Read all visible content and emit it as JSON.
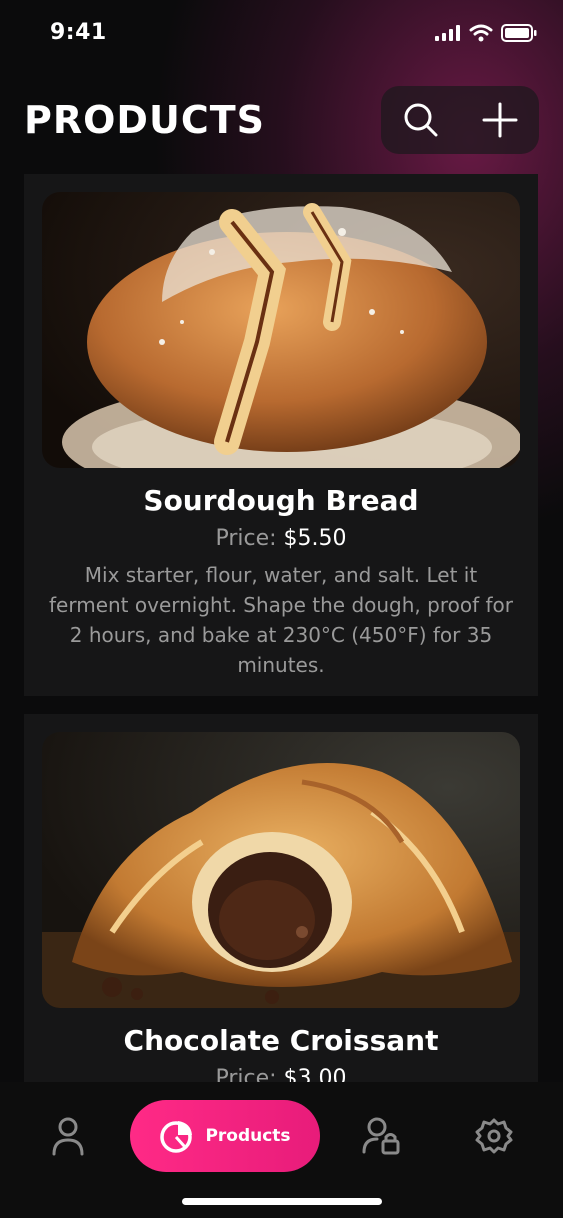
{
  "status": {
    "time": "9:41"
  },
  "header": {
    "title": "PRODUCTS"
  },
  "products": [
    {
      "name": "Sourdough Bread",
      "price_label": "Price:",
      "price_value": "$5.50",
      "description": "Mix starter, flour, water, and salt. Let it ferment overnight. Shape the dough, proof for 2 hours, and bake at 230°C (450°F) for 35 minutes."
    },
    {
      "name": "Chocolate Croissant",
      "price_label": "Price:",
      "price_value": "$3.00"
    }
  ],
  "tabbar": {
    "active_label": "Products",
    "items": [
      "profile-icon",
      "products-icon",
      "user-lock-icon",
      "settings-icon"
    ]
  },
  "colors": {
    "accent": "#ff2a86",
    "background": "#0b0b0c",
    "card": "#161617"
  }
}
